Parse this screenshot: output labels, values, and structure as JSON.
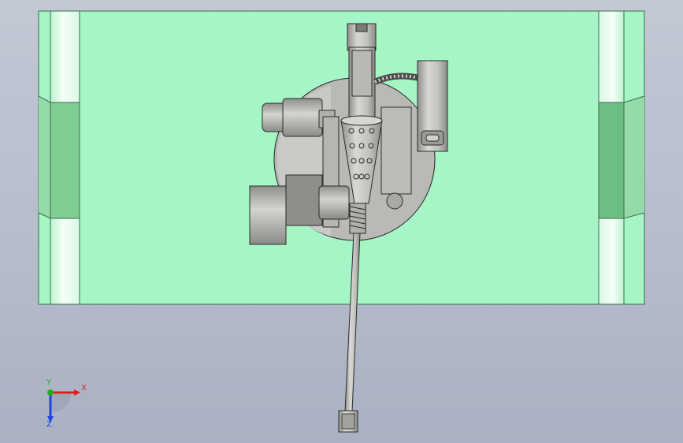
{
  "viewport": {
    "kind": "cad-3d-view",
    "background": [
      "#c2c8d4",
      "#a9b1c2"
    ]
  },
  "model": {
    "colors": {
      "mold_plate": "#a6f5c6",
      "mold_plate_edge": "#3c6a4a",
      "side_rail_light": "#e8fbee",
      "side_rail_shade": "#7fcf95",
      "metal_part": "#c4c4c0",
      "metal_dark": "#8e8e8a",
      "metal_edge": "#2b2b2b"
    }
  },
  "triad": {
    "x_label": "X",
    "y_label": "Y",
    "z_label": "Z",
    "x_color": "#e02020",
    "y_color": "#20b020",
    "z_color": "#2040e0"
  }
}
